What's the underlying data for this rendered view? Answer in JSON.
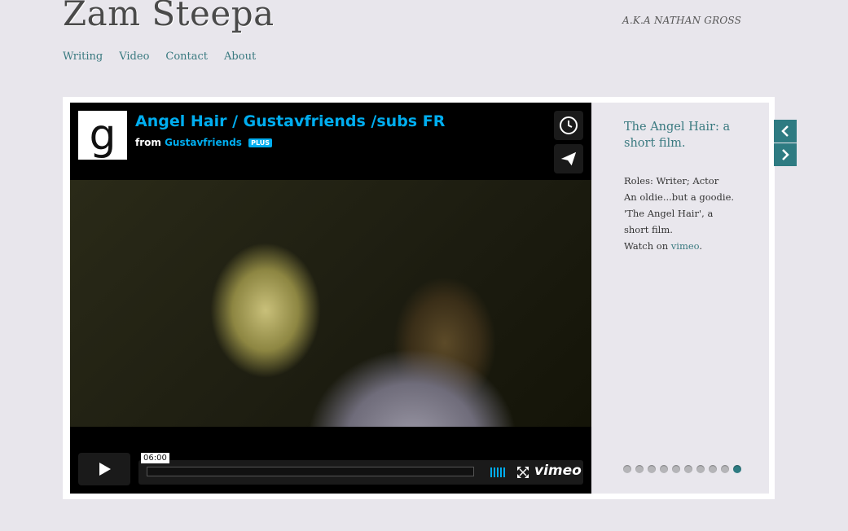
{
  "site": {
    "title": "Zam Steepa",
    "tagline": "A.K.A NATHAN GROSS"
  },
  "nav": {
    "items": [
      {
        "label": "Writing"
      },
      {
        "label": "Video"
      },
      {
        "label": "Contact"
      },
      {
        "label": "About"
      }
    ]
  },
  "video": {
    "channel_logo": "g",
    "title": "Angel Hair / Gustavfriends /subs FR",
    "from_label": "from",
    "author": "Gustavfriends",
    "badge": "PLUS",
    "timecode": "06:00",
    "brand": "vimeo",
    "icons": {
      "clock": "clock-icon",
      "send": "paper-plane-icon",
      "play": "play-icon",
      "fullscreen": "fullscreen-icon"
    }
  },
  "info": {
    "heading": "The Angel Hair: a short film.",
    "roles": "Roles: Writer; Actor",
    "line2": "An oldie...but a goodie.",
    "line3": "'The Angel Hair', a short film.",
    "watch_prefix": "Watch on ",
    "watch_link": "vimeo",
    "watch_suffix": "."
  },
  "slider": {
    "total_slides": 10,
    "active_slide": 10
  },
  "colors": {
    "accent": "#2e7b82",
    "vimeo_blue": "#00adef",
    "background": "#e8e6ec"
  }
}
